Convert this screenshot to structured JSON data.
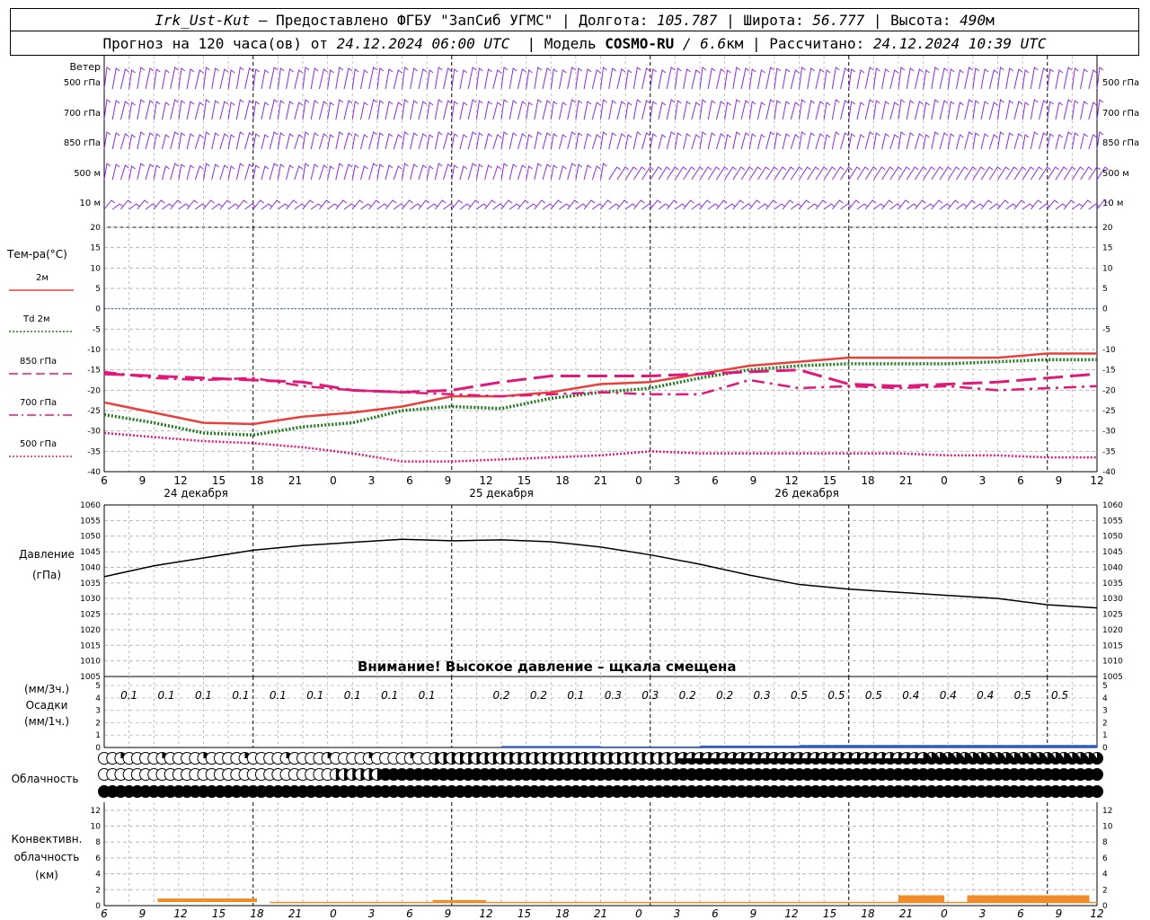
{
  "header": {
    "station": "Irk_Ust-Kut",
    "provider": " – Предоставлено ФГБУ \"ЗапСиб УГМС\" | ",
    "lon_label": "Долгота: ",
    "lon": "105.787",
    "lat_label": " | Широта: ",
    "lat": "56.777",
    "alt_label": " | Высота: ",
    "alt": "490",
    "alt_unit": "м",
    "forecast_label": "Прогноз на 120 часа(ов) от ",
    "forecast_start": "24.12.2024 06:00 UTC",
    "model_label": "  | Модель ",
    "model": "COSMO-RU",
    "model_res": " / 6.6",
    "model_res_unit": "км",
    "calc_label": " | Рассчитано: ",
    "calc_time": "24.12.2024 10:39 UTC"
  },
  "warning": "Внимание! Высокое давление – щкала смещена",
  "panels": {
    "wind": {
      "label": "Ветер",
      "levels": [
        "500 гПа",
        "700 гПа",
        "850 гПа",
        "500 м",
        "10 м"
      ],
      "color": "#8a2be2"
    },
    "temperature": {
      "label": "Тем-ра(°C)",
      "legend": [
        {
          "name": "2м",
          "color": "#e8413c",
          "style": "solid"
        },
        {
          "name": "Td 2м",
          "color": "#1f7a1f",
          "style": "dotted"
        },
        {
          "name": "850 гПа",
          "color": "#e0187a",
          "style": "dash"
        },
        {
          "name": "700 гПа",
          "color": "#e0187a",
          "style": "dashdot"
        },
        {
          "name": "500 гПа",
          "color": "#e0187a",
          "style": "dotted"
        }
      ]
    },
    "pressure": {
      "label": "Давление",
      "unit": "(гПа)"
    },
    "precip": {
      "unit_top": "(мм/3ч.)",
      "label": "Осадки",
      "unit_bottom": "(мм/1ч.)"
    },
    "cloud": {
      "label": "Облачность"
    },
    "convective": {
      "label1": "Конвективн.",
      "label2": "облачность",
      "unit": "(км)"
    }
  },
  "chart_data": [
    {
      "type": "line",
      "title": "Тем-ра(°C)",
      "ylim": [
        -40,
        20
      ],
      "yticks": [
        20,
        15,
        10,
        5,
        0,
        -5,
        -10,
        -15,
        -20,
        -25,
        -30,
        -35,
        -40
      ],
      "x": [
        0,
        6,
        12,
        18,
        24,
        30,
        36,
        42,
        48,
        54,
        60,
        66,
        72,
        78,
        84,
        90,
        96,
        102,
        108,
        114,
        120
      ],
      "xticks": [
        "6",
        "9",
        "12",
        "15",
        "18",
        "21",
        "0",
        "3",
        "6",
        "9",
        "12",
        "15",
        "18",
        "21",
        "0",
        "3",
        "6",
        "9",
        "12",
        "15",
        "18",
        "21",
        "0",
        "3",
        "6",
        "9",
        "12"
      ],
      "date_labels": [
        "24 декабря",
        "25 декабря",
        "26 декабря"
      ],
      "series": [
        {
          "name": "2м",
          "color": "#e8413c",
          "values": [
            -23,
            -25.5,
            -28,
            -28.3,
            -26.5,
            -25.5,
            -24,
            -21.5,
            -21.5,
            -20.5,
            -18.5,
            -18,
            -16,
            -14,
            -13,
            -12,
            -12,
            -12,
            -12,
            -11,
            -11
          ]
        },
        {
          "name": "Td 2м",
          "color": "#1f7a1f",
          "values": [
            -26,
            -28,
            -30.5,
            -31,
            -29,
            -28,
            -25,
            -24,
            -24.5,
            -22,
            -20.5,
            -19.5,
            -17,
            -15,
            -14,
            -13.5,
            -13.5,
            -13.5,
            -13,
            -12.5,
            -12.5
          ]
        },
        {
          "name": "850 гПа",
          "color": "#e0187a",
          "values": [
            -16,
            -16.5,
            -17,
            -17.5,
            -18,
            -20,
            -20.5,
            -20,
            -18,
            -16.5,
            -16.5,
            -16.5,
            -16,
            -15.5,
            -15,
            -18.5,
            -19,
            -18.5,
            -18,
            -17,
            -16
          ]
        },
        {
          "name": "700 гПа",
          "color": "#e0187a",
          "values": [
            -15.5,
            -17,
            -17.5,
            -17,
            -19,
            -20,
            -20.5,
            -21,
            -21.5,
            -21,
            -20.5,
            -21,
            -21,
            -17.5,
            -19.5,
            -19,
            -19.5,
            -19,
            -20,
            -19.5,
            -19
          ]
        },
        {
          "name": "500 гПа",
          "color": "#e0187a",
          "values": [
            -30.5,
            -31.5,
            -32.5,
            -33,
            -34,
            -35.5,
            -37.5,
            -37.5,
            -37,
            -36.5,
            -36,
            -35,
            -35.5,
            -35.5,
            -35.5,
            -35.5,
            -35.5,
            -36,
            -36,
            -36.5,
            -36.5
          ]
        }
      ]
    },
    {
      "type": "line",
      "title": "Давление",
      "ylabel": "(гПа)",
      "ylim": [
        1005,
        1060
      ],
      "yticks": [
        1060,
        1055,
        1050,
        1045,
        1040,
        1035,
        1030,
        1025,
        1020,
        1015,
        1010,
        1005
      ],
      "x": [
        0,
        6,
        12,
        18,
        24,
        30,
        36,
        42,
        48,
        54,
        60,
        66,
        72,
        78,
        84,
        90,
        96,
        102,
        108,
        114,
        120
      ],
      "series": [
        {
          "name": "Давление",
          "color": "#000000",
          "values": [
            1037,
            1040.5,
            1043,
            1045.5,
            1047,
            1048,
            1049,
            1048.5,
            1048.8,
            1048.2,
            1046.5,
            1044,
            1041,
            1037.5,
            1034.5,
            1033,
            1032,
            1031,
            1030,
            1028,
            1027
          ]
        }
      ]
    },
    {
      "type": "bar",
      "title": "Осадки",
      "ylim": [
        0,
        5
      ],
      "labels_mm3h": [
        "0.1",
        "0.1",
        "0.1",
        "0.1",
        "0.1",
        "0.1",
        "0.1",
        "0.1",
        "0.1",
        "",
        "0.2",
        "0.2",
        "0.1",
        "0.3",
        "0.3",
        "0.2",
        "0.2",
        "0.3",
        "0.5",
        "0.5",
        "0.5",
        "0.4",
        "0.4",
        "0.4",
        "0.5",
        "0.5"
      ]
    },
    {
      "type": "bar",
      "title": "Конвективн. облачность (км)",
      "ylim": [
        0,
        13
      ],
      "yticks": [
        12,
        10,
        8,
        6,
        4,
        2,
        0
      ],
      "color": "#f28c28",
      "blocks": [
        {
          "x0": 7,
          "x1": 20,
          "value": 0.9
        },
        {
          "x0": 43,
          "x1": 50,
          "value": 0.7
        },
        {
          "x0": 104,
          "x1": 110,
          "value": 1.3
        },
        {
          "x0": 113,
          "x1": 129,
          "value": 1.3
        }
      ]
    }
  ]
}
